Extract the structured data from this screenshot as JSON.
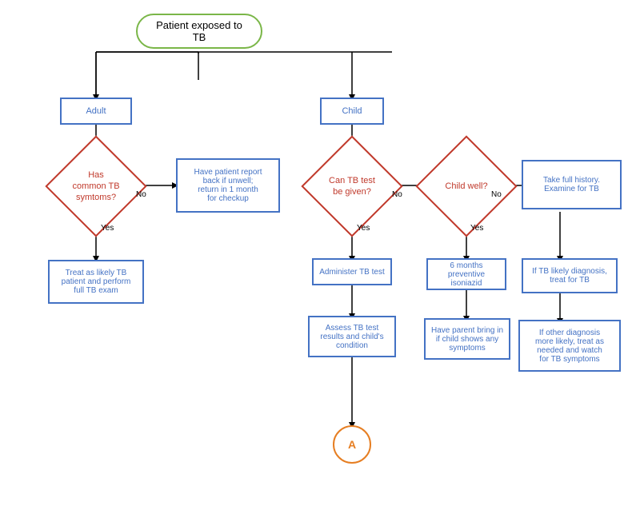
{
  "nodes": {
    "start": {
      "label": "Patient exposed to TB"
    },
    "adult": {
      "label": "Adult"
    },
    "child": {
      "label": "Child"
    },
    "has_symptoms": {
      "label": "Has\ncommon TB\nsymtoms?"
    },
    "report_back": {
      "label": "Have patient report\nback if unwell;\nreturn in 1 month\nfor checkup"
    },
    "treat_adult": {
      "label": "Treat as likely TB\npatient and perform\nfull TB exam"
    },
    "can_tb_test": {
      "label": "Can TB test\nbe given?"
    },
    "child_well": {
      "label": "Child well?"
    },
    "take_history": {
      "label": "Take full history.\nExamine for TB"
    },
    "administer": {
      "label": "Administer TB test"
    },
    "six_months": {
      "label": "6 months\npreventive isoniazid"
    },
    "tb_likely": {
      "label": "If TB likely diagnosis,\ntreat for TB"
    },
    "assess": {
      "label": "Assess TB test\nresults and child's\ncondition"
    },
    "parent_bring": {
      "label": "Have parent bring in\nif child shows any\nsymptoms"
    },
    "other_diagnosis": {
      "label": "If other diagnosis\nmore likely, treat as\nneeded and watch\nfor TB symptoms"
    },
    "connector_a": {
      "label": "A"
    }
  },
  "labels": {
    "no1": "No",
    "yes1": "Yes",
    "no2": "No",
    "yes2": "Yes",
    "no3": "No",
    "yes3": "Yes"
  }
}
